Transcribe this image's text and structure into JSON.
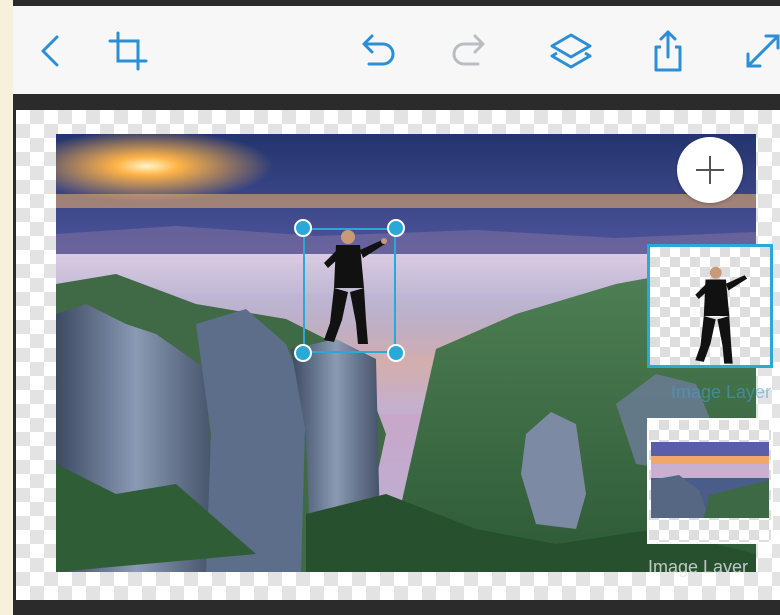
{
  "toolbar": {
    "icons": [
      "back-chevron-icon",
      "crop-icon",
      "undo-icon",
      "redo-icon",
      "layers-icon",
      "share-icon",
      "expand-icon"
    ]
  },
  "colors": {
    "accent": "#2aa9d6",
    "toolbar_icon": "#2a8fd6",
    "disabled_icon": "#b9bcc0",
    "toolbar_bg": "#f7f7f8"
  },
  "canvas": {
    "add_layer_icon": "plus-icon",
    "layers": [
      {
        "label": "Image Layer",
        "selected": true,
        "content": "person cutout"
      },
      {
        "label": "Image Layer",
        "selected": false,
        "content": "mountain landscape"
      }
    ]
  }
}
